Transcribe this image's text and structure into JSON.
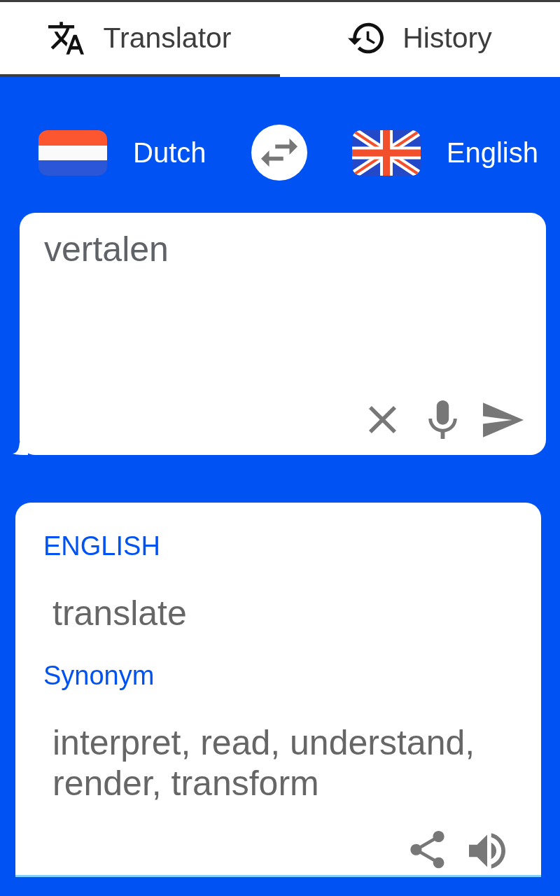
{
  "tabs": [
    {
      "label": "Translator",
      "selected": true
    },
    {
      "label": "History",
      "selected": false
    }
  ],
  "languages": {
    "source": "Dutch",
    "target": "English"
  },
  "input": {
    "value": "vertalen"
  },
  "result": {
    "language_heading": "ENGLISH",
    "translation": "translate",
    "synonym_heading": "Synonym",
    "synonyms": "interpret, read, understand, render, transform"
  }
}
